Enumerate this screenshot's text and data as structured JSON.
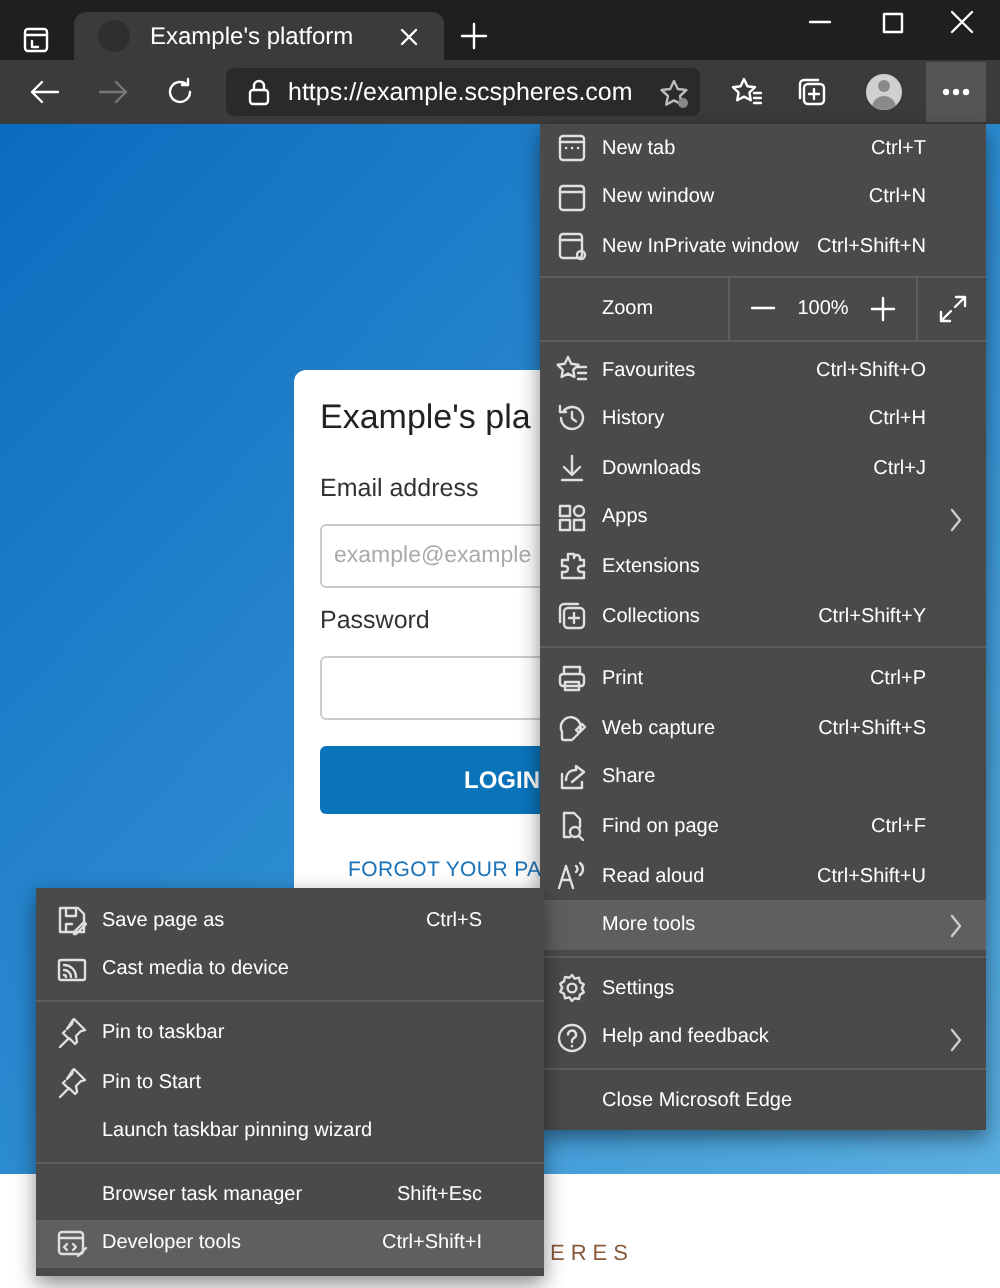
{
  "tab_strip": {
    "tabs": [
      {
        "title": "Example's platform",
        "selected": true
      }
    ]
  },
  "toolbar": {
    "back": {
      "disabled": false
    },
    "forward": {
      "disabled": true
    },
    "address": {
      "url": "https://example.scspheres.com"
    },
    "more_button": {
      "selected": true
    }
  },
  "page": {
    "login_card": {
      "title": "Example's pla",
      "email_label": "Email address",
      "email_placeholder": "example@example",
      "password_label": "Password",
      "login_button": "LOGIN",
      "forgot_link": "FORGOT YOUR PA"
    },
    "footer_text": "ERES"
  },
  "menu": {
    "sections": [
      {
        "kind": "items",
        "items": [
          {
            "label": "New tab",
            "shortcut": "Ctrl+T",
            "has_submenu": false,
            "highlighted": false
          },
          {
            "label": "New window",
            "shortcut": "Ctrl+N",
            "has_submenu": false,
            "highlighted": false
          },
          {
            "label": "New InPrivate window",
            "shortcut": "Ctrl+Shift+N",
            "has_submenu": false,
            "highlighted": false
          }
        ]
      },
      {
        "kind": "zoom",
        "label": "Zoom",
        "value": "100%"
      },
      {
        "kind": "items",
        "items": [
          {
            "label": "Favourites",
            "shortcut": "Ctrl+Shift+O",
            "has_submenu": false,
            "highlighted": false
          },
          {
            "label": "History",
            "shortcut": "Ctrl+H",
            "has_submenu": false,
            "highlighted": false
          },
          {
            "label": "Downloads",
            "shortcut": "Ctrl+J",
            "has_submenu": false,
            "highlighted": false
          },
          {
            "label": "Apps",
            "has_submenu": true,
            "highlighted": false
          },
          {
            "label": "Extensions",
            "has_submenu": false,
            "highlighted": false
          },
          {
            "label": "Collections",
            "shortcut": "Ctrl+Shift+Y",
            "has_submenu": false,
            "highlighted": false
          }
        ]
      },
      {
        "kind": "items",
        "items": [
          {
            "label": "Print",
            "shortcut": "Ctrl+P",
            "has_submenu": false,
            "highlighted": false
          },
          {
            "label": "Web capture",
            "shortcut": "Ctrl+Shift+S",
            "has_submenu": false,
            "highlighted": false
          },
          {
            "label": "Share",
            "has_submenu": false,
            "highlighted": false
          },
          {
            "label": "Find on page",
            "shortcut": "Ctrl+F",
            "has_submenu": false,
            "highlighted": false
          },
          {
            "label": "Read aloud",
            "shortcut": "Ctrl+Shift+U",
            "has_submenu": false,
            "highlighted": false
          },
          {
            "label": "More tools",
            "has_submenu": true,
            "highlighted": true
          }
        ]
      },
      {
        "kind": "items",
        "items": [
          {
            "label": "Settings",
            "has_submenu": false,
            "highlighted": false
          },
          {
            "label": "Help and feedback",
            "has_submenu": true,
            "highlighted": false
          }
        ]
      },
      {
        "kind": "items",
        "items": [
          {
            "label": "Close Microsoft Edge",
            "has_submenu": false,
            "highlighted": false
          }
        ]
      }
    ]
  },
  "submenu": {
    "sections": [
      {
        "items": [
          {
            "label": "Save page as",
            "shortcut": "Ctrl+S",
            "highlighted": false
          },
          {
            "label": "Cast media to device",
            "highlighted": false
          }
        ]
      },
      {
        "items": [
          {
            "label": "Pin to taskbar",
            "highlighted": false
          },
          {
            "label": "Pin to Start",
            "highlighted": false
          },
          {
            "label": "Launch taskbar pinning wizard",
            "highlighted": false
          }
        ]
      },
      {
        "items": [
          {
            "label": "Browser task manager",
            "shortcut": "Shift+Esc",
            "highlighted": false
          },
          {
            "label": "Developer tools",
            "shortcut": "Ctrl+Shift+I",
            "highlighted": true
          }
        ]
      }
    ]
  }
}
